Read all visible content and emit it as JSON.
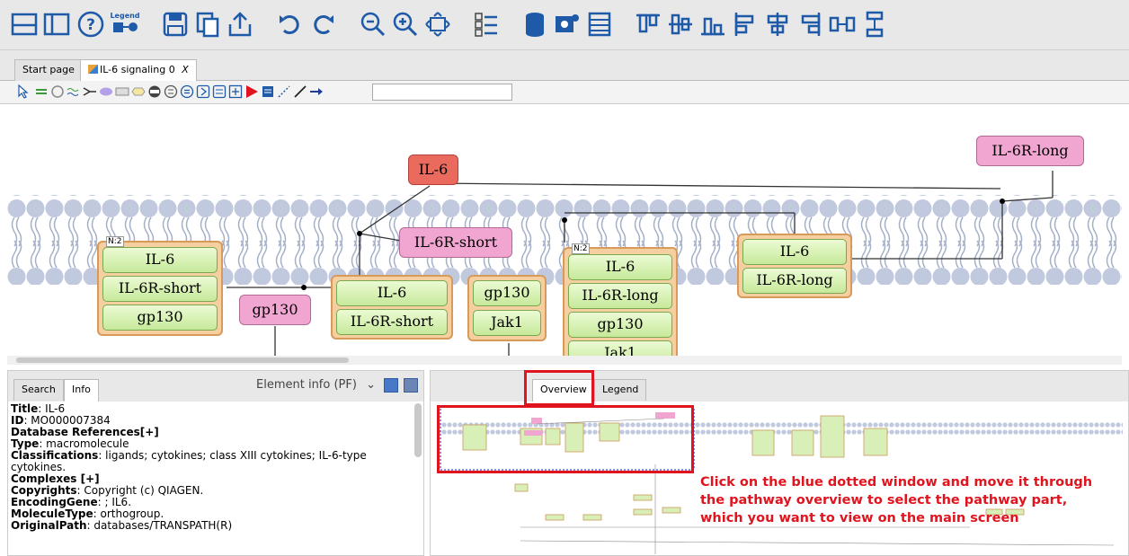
{
  "toolbar": {
    "legend_label": "Legend"
  },
  "tabs": [
    {
      "label": "Start page"
    },
    {
      "label": "IL-6 signaling 0",
      "close": "X"
    }
  ],
  "canvas": {
    "il6": "IL-6",
    "il6r_long_top": "IL-6R-long",
    "il6r_short_pink": "IL-6R-short",
    "gp130_pink": "gp130",
    "c1_badge": "N:2",
    "c1": [
      "IL-6",
      "IL-6R-short",
      "gp130"
    ],
    "c2": [
      "IL-6",
      "IL-6R-short"
    ],
    "c3": [
      "gp130",
      "Jak1"
    ],
    "c4_badge": "N:2",
    "c4": [
      "IL-6",
      "IL-6R-long",
      "gp130",
      "Jak1"
    ],
    "c5": [
      "IL-6",
      "IL-6R-long"
    ]
  },
  "left": {
    "tabs": [
      "Search",
      "Info"
    ],
    "select": "Element info (PF)",
    "info": [
      {
        "k": "Title",
        "v": " IL-6"
      },
      {
        "k": "ID",
        "v": " MO000007384"
      },
      {
        "k": "Database References[+]",
        "v": ""
      },
      {
        "k": "Type",
        "v": " macromolecule"
      },
      {
        "k": "Classifications",
        "v": " ligands; cytokines; class XIII cytokines; IL-6-type cytokines."
      },
      {
        "k": "Complexes [+]",
        "v": ""
      },
      {
        "k": "Copyrights",
        "v": " Copyright (c) QIAGEN."
      },
      {
        "k": "EncodingGene",
        "v": " ; IL6."
      },
      {
        "k": "MoleculeType",
        "v": " orthogroup."
      },
      {
        "k": "OriginalPath",
        "v": " databases/TRANSPATH(R)"
      }
    ]
  },
  "right": {
    "tabs": [
      "Overview",
      "Legend"
    ],
    "note": "Click on the blue dotted window and move it through the pathway overview to select the pathway part, which you want to view on the main screen"
  },
  "colors": {
    "accent_red": "#e0141e",
    "toolbar_blue": "#1f5aa8",
    "node_green": "#c6e99a",
    "pink": "#f0a6d0"
  }
}
